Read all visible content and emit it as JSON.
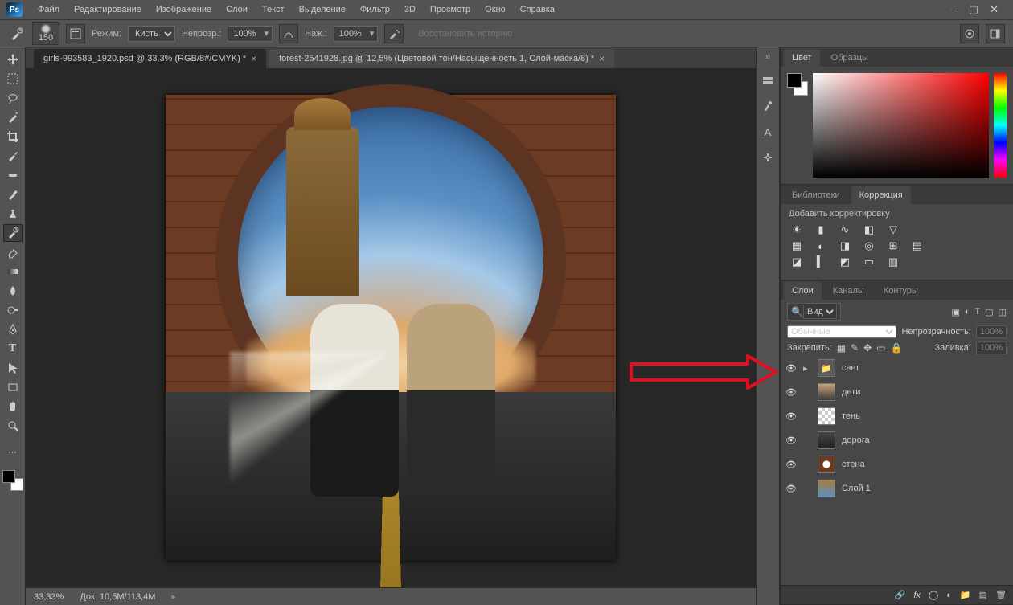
{
  "menu": {
    "items": [
      "Файл",
      "Редактирование",
      "Изображение",
      "Слои",
      "Текст",
      "Выделение",
      "Фильтр",
      "3D",
      "Просмотр",
      "Окно",
      "Справка"
    ]
  },
  "optbar": {
    "brush_size": "150",
    "mode_label": "Режим:",
    "mode_value": "Кисть",
    "opacity_label": "Непрозр.:",
    "opacity_value": "100%",
    "flow_label": "Наж.:",
    "flow_value": "100%",
    "restore": "Восстановить историю"
  },
  "tabs": [
    {
      "title": "girls-993583_1920.psd @ 33,3% (RGB/8#/CMYK) *",
      "active": true
    },
    {
      "title": "forest-2541928.jpg @ 12,5% (Цветовой тон/Насыщенность 1, Слой-маска/8) *",
      "active": false
    }
  ],
  "status": {
    "zoom": "33,33%",
    "docsize_label": "Док:",
    "docsize": "10,5M/113,4M"
  },
  "panel_color": {
    "tabs": [
      "Цвет",
      "Образцы"
    ]
  },
  "panel_adj": {
    "tabs": [
      "Библиотеки",
      "Коррекция"
    ],
    "hint": "Добавить корректировку"
  },
  "panel_layers": {
    "tabs": [
      "Слои",
      "Каналы",
      "Контуры"
    ],
    "filter_kind": "Вид",
    "blend_mode": "Обычные",
    "opacity_label": "Непрозрачность:",
    "opacity_value": "100%",
    "lock_label": "Закрепить:",
    "fill_label": "Заливка:",
    "fill_value": "100%",
    "layers": [
      {
        "name": "свет",
        "type": "folder",
        "expandable": true
      },
      {
        "name": "дети",
        "type": "img"
      },
      {
        "name": "тень",
        "type": "trans"
      },
      {
        "name": "дорога",
        "type": "img"
      },
      {
        "name": "стена",
        "type": "img"
      },
      {
        "name": "Слой 1",
        "type": "img"
      }
    ]
  }
}
